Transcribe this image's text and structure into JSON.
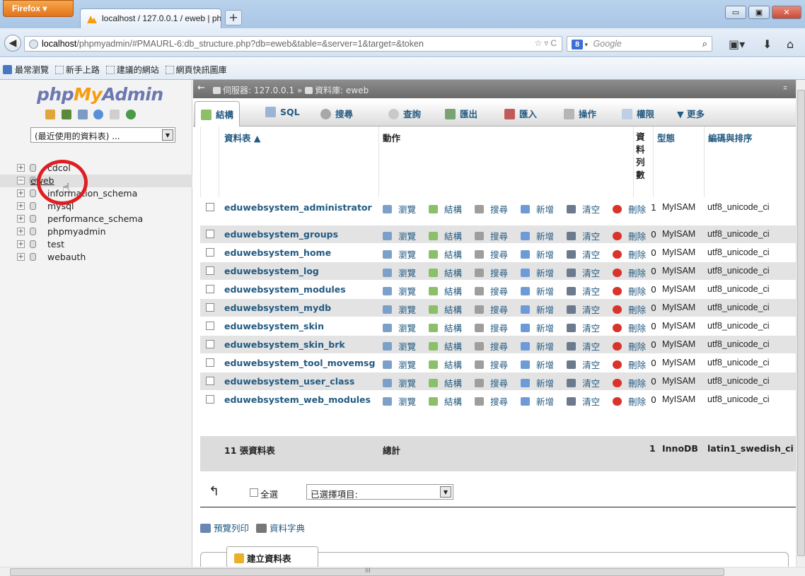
{
  "browser": {
    "menu_button": "Firefox ▾",
    "tab_title": "localhost / 127.0.0.1 / eweb | phpMyA...",
    "new_tab": "+",
    "url_host": "localhost",
    "url_rest": "/phpmyadmin/#PMAURL-6:db_structure.php?db=eweb&table=&server=1&target=&token",
    "search_placeholder": "Google",
    "window_min": "▭",
    "window_max": "▣",
    "window_close": "✕",
    "bookmarks": [
      "最常瀏覽",
      "新手上路",
      "建議的網站",
      "網頁快訊圖庫"
    ]
  },
  "sidebar": {
    "logo": {
      "php": "php",
      "my": "My",
      "admin": "Admin"
    },
    "recent_select": "(最近使用的資料表) ...",
    "databases": [
      {
        "name": "cdcol"
      },
      {
        "name": "eweb"
      },
      {
        "name": "information_schema"
      },
      {
        "name": "mysql"
      },
      {
        "name": "performance_schema"
      },
      {
        "name": "phpmyadmin"
      },
      {
        "name": "test"
      },
      {
        "name": "webauth"
      }
    ],
    "selected_db": "eweb"
  },
  "breadcrumb": {
    "server": "伺服器: 127.0.0.1",
    "separator": "»",
    "database": "資料庫: eweb"
  },
  "tabs": [
    {
      "label": "結構",
      "active": true
    },
    {
      "label": "SQL"
    },
    {
      "label": "搜尋"
    },
    {
      "label": "查詢"
    },
    {
      "label": "匯出"
    },
    {
      "label": "匯入"
    },
    {
      "label": "操作"
    },
    {
      "label": "權限"
    },
    {
      "label": "▼ 更多"
    }
  ],
  "table": {
    "headers": {
      "table": "資料表 ▲",
      "action": "動作",
      "rows": "資料列數",
      "type": "型態",
      "collation": "編碼與排序"
    },
    "actions": [
      "瀏覽",
      "結構",
      "搜尋",
      "新增",
      "清空",
      "刪除"
    ],
    "rows": [
      {
        "name": "eduwebsystem_administrator",
        "count": "1",
        "type": "MyISAM",
        "collation": "utf8_unicode_ci"
      },
      {
        "name": "eduwebsystem_groups",
        "count": "0",
        "type": "MyISAM",
        "collation": "utf8_unicode_ci"
      },
      {
        "name": "eduwebsystem_home",
        "count": "0",
        "type": "MyISAM",
        "collation": "utf8_unicode_ci"
      },
      {
        "name": "eduwebsystem_log",
        "count": "0",
        "type": "MyISAM",
        "collation": "utf8_unicode_ci"
      },
      {
        "name": "eduwebsystem_modules",
        "count": "0",
        "type": "MyISAM",
        "collation": "utf8_unicode_ci"
      },
      {
        "name": "eduwebsystem_mydb",
        "count": "0",
        "type": "MyISAM",
        "collation": "utf8_unicode_ci"
      },
      {
        "name": "eduwebsystem_skin",
        "count": "0",
        "type": "MyISAM",
        "collation": "utf8_unicode_ci"
      },
      {
        "name": "eduwebsystem_skin_brk",
        "count": "0",
        "type": "MyISAM",
        "collation": "utf8_unicode_ci"
      },
      {
        "name": "eduwebsystem_tool_movemsg",
        "count": "0",
        "type": "MyISAM",
        "collation": "utf8_unicode_ci"
      },
      {
        "name": "eduwebsystem_user_class",
        "count": "0",
        "type": "MyISAM",
        "collation": "utf8_unicode_ci"
      },
      {
        "name": "eduwebsystem_web_modules",
        "count": "0",
        "type": "MyISAM",
        "collation": "utf8_unicode_ci"
      }
    ],
    "summary": {
      "tables": "11 張資料表",
      "total_label": "總計",
      "count": "1",
      "type": "InnoDB",
      "collation": "latin1_swedish_ci"
    }
  },
  "bulk": {
    "check_all": "全選",
    "with_selected": "已選擇項目:"
  },
  "links": {
    "print": "預覽列印",
    "dictionary": "資料字典"
  },
  "create_table": "建立資料表",
  "colors": {
    "link": "#235a81",
    "logo_blue": "#6c78b0",
    "logo_orange": "#f89c0e",
    "highlight": "#e01e22"
  }
}
